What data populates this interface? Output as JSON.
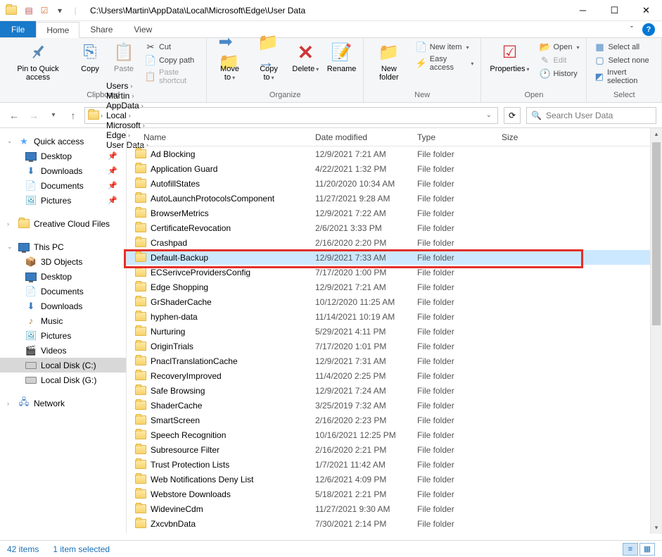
{
  "title": "C:\\Users\\Martin\\AppData\\Local\\Microsoft\\Edge\\User Data",
  "tabs": {
    "file": "File",
    "home": "Home",
    "share": "Share",
    "view": "View"
  },
  "ribbon": {
    "pin": "Pin to Quick access",
    "copy": "Copy",
    "paste": "Paste",
    "cut": "Cut",
    "copypath": "Copy path",
    "pastesc": "Paste shortcut",
    "moveto": "Move to",
    "copyto": "Copy to",
    "delete": "Delete",
    "rename": "Rename",
    "newfolder": "New folder",
    "newitem": "New item",
    "easyaccess": "Easy access",
    "properties": "Properties",
    "open": "Open",
    "edit": "Edit",
    "history": "History",
    "selectall": "Select all",
    "selectnone": "Select none",
    "invertsel": "Invert selection",
    "g_clipboard": "Clipboard",
    "g_organize": "Organize",
    "g_new": "New",
    "g_open": "Open",
    "g_select": "Select"
  },
  "breadcrumbs": [
    "Users",
    "Martin",
    "AppData",
    "Local",
    "Microsoft",
    "Edge",
    "User Data"
  ],
  "search_placeholder": "Search User Data",
  "columns": {
    "name": "Name",
    "date": "Date modified",
    "type": "Type",
    "size": "Size"
  },
  "nav": {
    "quick": "Quick access",
    "desktop": "Desktop",
    "downloads": "Downloads",
    "documents": "Documents",
    "pictures": "Pictures",
    "ccf": "Creative Cloud Files",
    "thispc": "This PC",
    "3d": "3D Objects",
    "desk2": "Desktop",
    "docs2": "Documents",
    "dl2": "Downloads",
    "music": "Music",
    "pics2": "Pictures",
    "videos": "Videos",
    "diskc": "Local Disk (C:)",
    "diskg": "Local Disk (G:)",
    "network": "Network"
  },
  "files": [
    {
      "n": "Ad Blocking",
      "d": "12/9/2021 7:21 AM",
      "t": "File folder"
    },
    {
      "n": "Application Guard",
      "d": "4/22/2021 1:32 PM",
      "t": "File folder"
    },
    {
      "n": "AutofillStates",
      "d": "11/20/2020 10:34 AM",
      "t": "File folder"
    },
    {
      "n": "AutoLaunchProtocolsComponent",
      "d": "11/27/2021 9:28 AM",
      "t": "File folder"
    },
    {
      "n": "BrowserMetrics",
      "d": "12/9/2021 7:22 AM",
      "t": "File folder"
    },
    {
      "n": "CertificateRevocation",
      "d": "2/6/2021 3:33 PM",
      "t": "File folder"
    },
    {
      "n": "Crashpad",
      "d": "2/16/2020 2:20 PM",
      "t": "File folder"
    },
    {
      "n": "Default-Backup",
      "d": "12/9/2021 7:33 AM",
      "t": "File folder",
      "sel": true
    },
    {
      "n": "ECSerivceProvidersConfig",
      "d": "7/17/2020 1:00 PM",
      "t": "File folder"
    },
    {
      "n": "Edge Shopping",
      "d": "12/9/2021 7:21 AM",
      "t": "File folder"
    },
    {
      "n": "GrShaderCache",
      "d": "10/12/2020 11:25 AM",
      "t": "File folder"
    },
    {
      "n": "hyphen-data",
      "d": "11/14/2021 10:19 AM",
      "t": "File folder"
    },
    {
      "n": "Nurturing",
      "d": "5/29/2021 4:11 PM",
      "t": "File folder"
    },
    {
      "n": "OriginTrials",
      "d": "7/17/2020 1:01 PM",
      "t": "File folder"
    },
    {
      "n": "PnaclTranslationCache",
      "d": "12/9/2021 7:31 AM",
      "t": "File folder"
    },
    {
      "n": "RecoveryImproved",
      "d": "11/4/2020 2:25 PM",
      "t": "File folder"
    },
    {
      "n": "Safe Browsing",
      "d": "12/9/2021 7:24 AM",
      "t": "File folder"
    },
    {
      "n": "ShaderCache",
      "d": "3/25/2019 7:32 AM",
      "t": "File folder"
    },
    {
      "n": "SmartScreen",
      "d": "2/16/2020 2:23 PM",
      "t": "File folder"
    },
    {
      "n": "Speech Recognition",
      "d": "10/16/2021 12:25 PM",
      "t": "File folder"
    },
    {
      "n": "Subresource Filter",
      "d": "2/16/2020 2:21 PM",
      "t": "File folder"
    },
    {
      "n": "Trust Protection Lists",
      "d": "1/7/2021 11:42 AM",
      "t": "File folder"
    },
    {
      "n": "Web Notifications Deny List",
      "d": "12/6/2021 4:09 PM",
      "t": "File folder"
    },
    {
      "n": "Webstore Downloads",
      "d": "5/18/2021 2:21 PM",
      "t": "File folder"
    },
    {
      "n": "WidevineCdm",
      "d": "11/27/2021 9:30 AM",
      "t": "File folder"
    },
    {
      "n": "ZxcvbnData",
      "d": "7/30/2021 2:14 PM",
      "t": "File folder"
    }
  ],
  "status": {
    "items": "42 items",
    "selected": "1 item selected"
  }
}
